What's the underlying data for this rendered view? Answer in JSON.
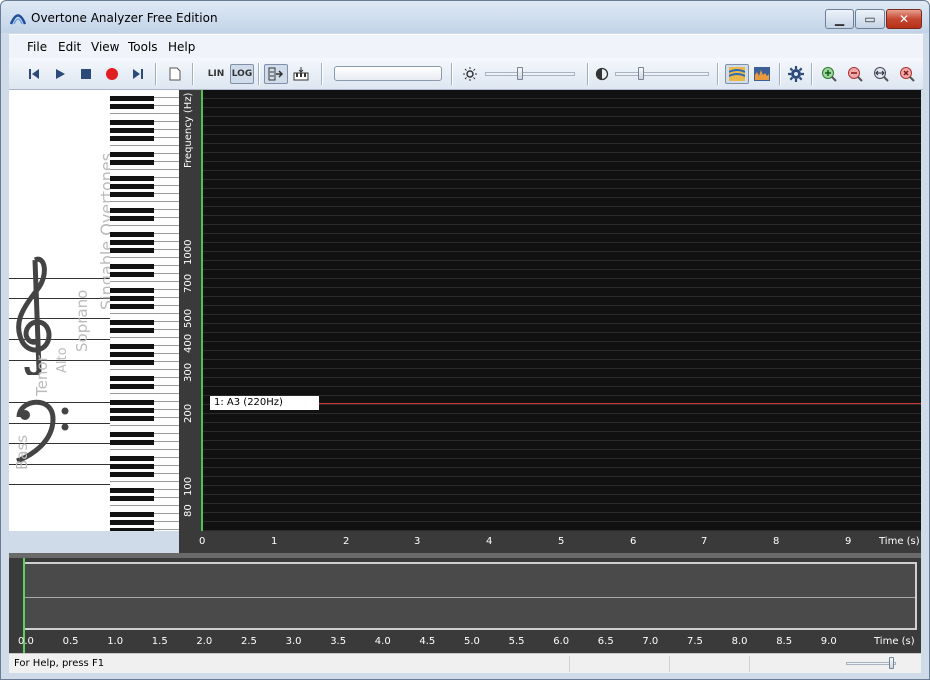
{
  "window": {
    "title": "Overtone Analyzer Free Edition"
  },
  "menu": [
    "File",
    "Edit",
    "View",
    "Tools",
    "Help"
  ],
  "toolbar": {
    "lin": "LIN",
    "log": "LOG"
  },
  "left_panel": {
    "labels": [
      "Singable Overtones",
      "Soprano",
      "Alto",
      "Tenor",
      "Bass"
    ]
  },
  "frequency_axis": {
    "title": "Frequency (Hz)",
    "ticks": [
      "1000",
      "700",
      "500",
      "400",
      "300",
      "200",
      "100",
      "80"
    ]
  },
  "note_marker": {
    "label": "1: A3 (220Hz)",
    "color": "#cc3333"
  },
  "time_axis": {
    "title": "Time (s)",
    "ticks": [
      "0",
      "1",
      "2",
      "3",
      "4",
      "5",
      "6",
      "7",
      "8",
      "9"
    ]
  },
  "wave_axis": {
    "title": "Time (s)",
    "ticks": [
      "0.0",
      "0.5",
      "1.0",
      "1.5",
      "2.0",
      "2.5",
      "3.0",
      "3.5",
      "4.0",
      "4.5",
      "5.0",
      "5.5",
      "6.0",
      "6.5",
      "7.0",
      "7.5",
      "8.0",
      "8.5",
      "9.0"
    ]
  },
  "status": {
    "help": "For Help, press F1"
  },
  "colors": {
    "cursor": "#4fc34f",
    "record": "#e02020",
    "background": "#111111"
  }
}
